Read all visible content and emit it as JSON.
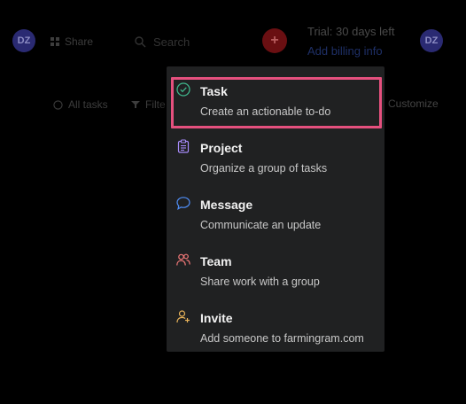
{
  "header": {
    "left_avatar_initials": "DZ",
    "share_label": "Share",
    "search_placeholder": "Search",
    "add_icon": "plus-icon",
    "trial_text": "Trial: 30 days left",
    "billing_link": "Add billing info",
    "right_avatar_initials": "DZ"
  },
  "toolbar": {
    "all_tasks_label": "All tasks",
    "filter_label": "Filte",
    "customize_label": "Customize"
  },
  "menu": {
    "items": [
      {
        "title": "Task",
        "description": "Create an actionable to-do",
        "icon": "check-circle-icon",
        "color": "#3fb68b",
        "highlighted": true
      },
      {
        "title": "Project",
        "description": "Organize a group of tasks",
        "icon": "clipboard-icon",
        "color": "#a78bfa"
      },
      {
        "title": "Message",
        "description": "Communicate an update",
        "icon": "chat-bubble-icon",
        "color": "#4f8ef7"
      },
      {
        "title": "Team",
        "description": "Share work with a group",
        "icon": "people-icon",
        "color": "#f07878"
      },
      {
        "title": "Invite",
        "description": "Add someone to farmingram.com",
        "icon": "add-person-icon",
        "color": "#e8b35a"
      }
    ],
    "highlight_color": "#e5507e"
  }
}
